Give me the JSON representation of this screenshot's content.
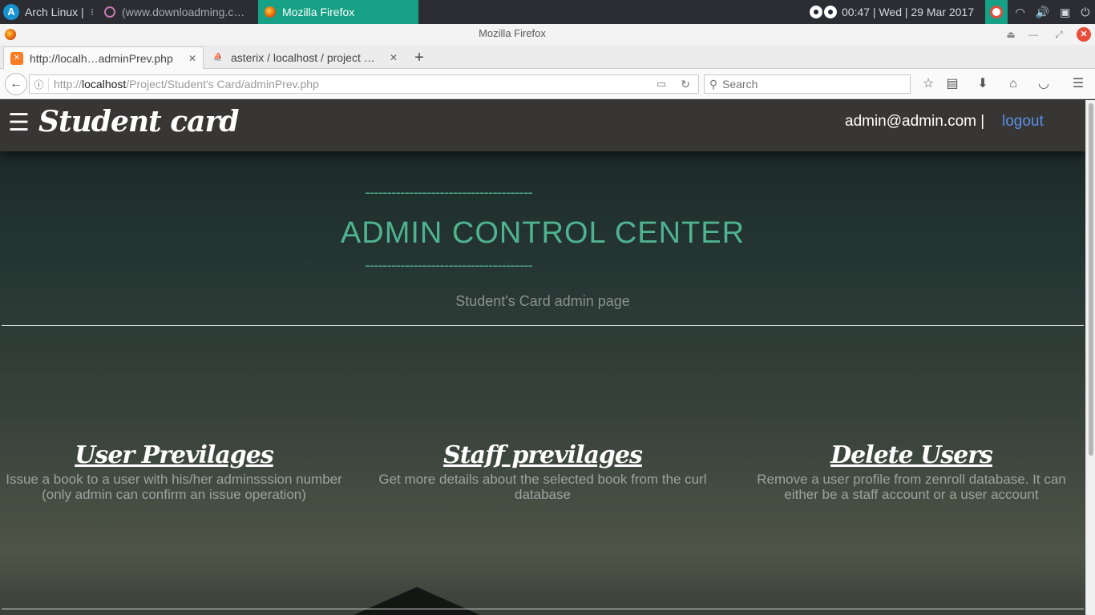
{
  "panel": {
    "workspace_label": "Arch Linux |",
    "tasks": [
      "(www.downloadming.c…",
      "Mozilla Firefox"
    ],
    "clock": "00:47  |  Wed  |  29 Mar 2017"
  },
  "window": {
    "title": "Mozilla Firefox"
  },
  "tabs": [
    {
      "label": "http://localh…adminPrev.php",
      "favicon": "xampp-icon"
    },
    {
      "label": "asterix / localhost / project …",
      "favicon": "phpmyadmin-icon"
    }
  ],
  "navbar": {
    "url_prefix": "http://",
    "url_host": "localhost",
    "url_path": "/Project/Student's Card/adminPrev.php",
    "search_placeholder": "Search"
  },
  "site": {
    "brand": "Student card",
    "user_email": "admin@admin.com |",
    "logout_label": "logout",
    "dashes": "--------------------------------------",
    "heading": "ADMIN CONTROL CENTER",
    "subtitle": "Student's Card admin page"
  },
  "features": [
    {
      "title": "User Previlages",
      "desc": "Issue a book to a user with his/her adminsssion number (only admin can confirm an issue operation)"
    },
    {
      "title": "Staff previlages",
      "desc": "Get more details about the selected book from the curl database"
    },
    {
      "title": "Delete Users",
      "desc": "Remove a user profile from zenroll database. It can either be a staff account or a user account"
    }
  ],
  "colors": {
    "accent": "#4fb390",
    "logout_link": "#5d8fe6",
    "panel_active": "#16a085"
  }
}
